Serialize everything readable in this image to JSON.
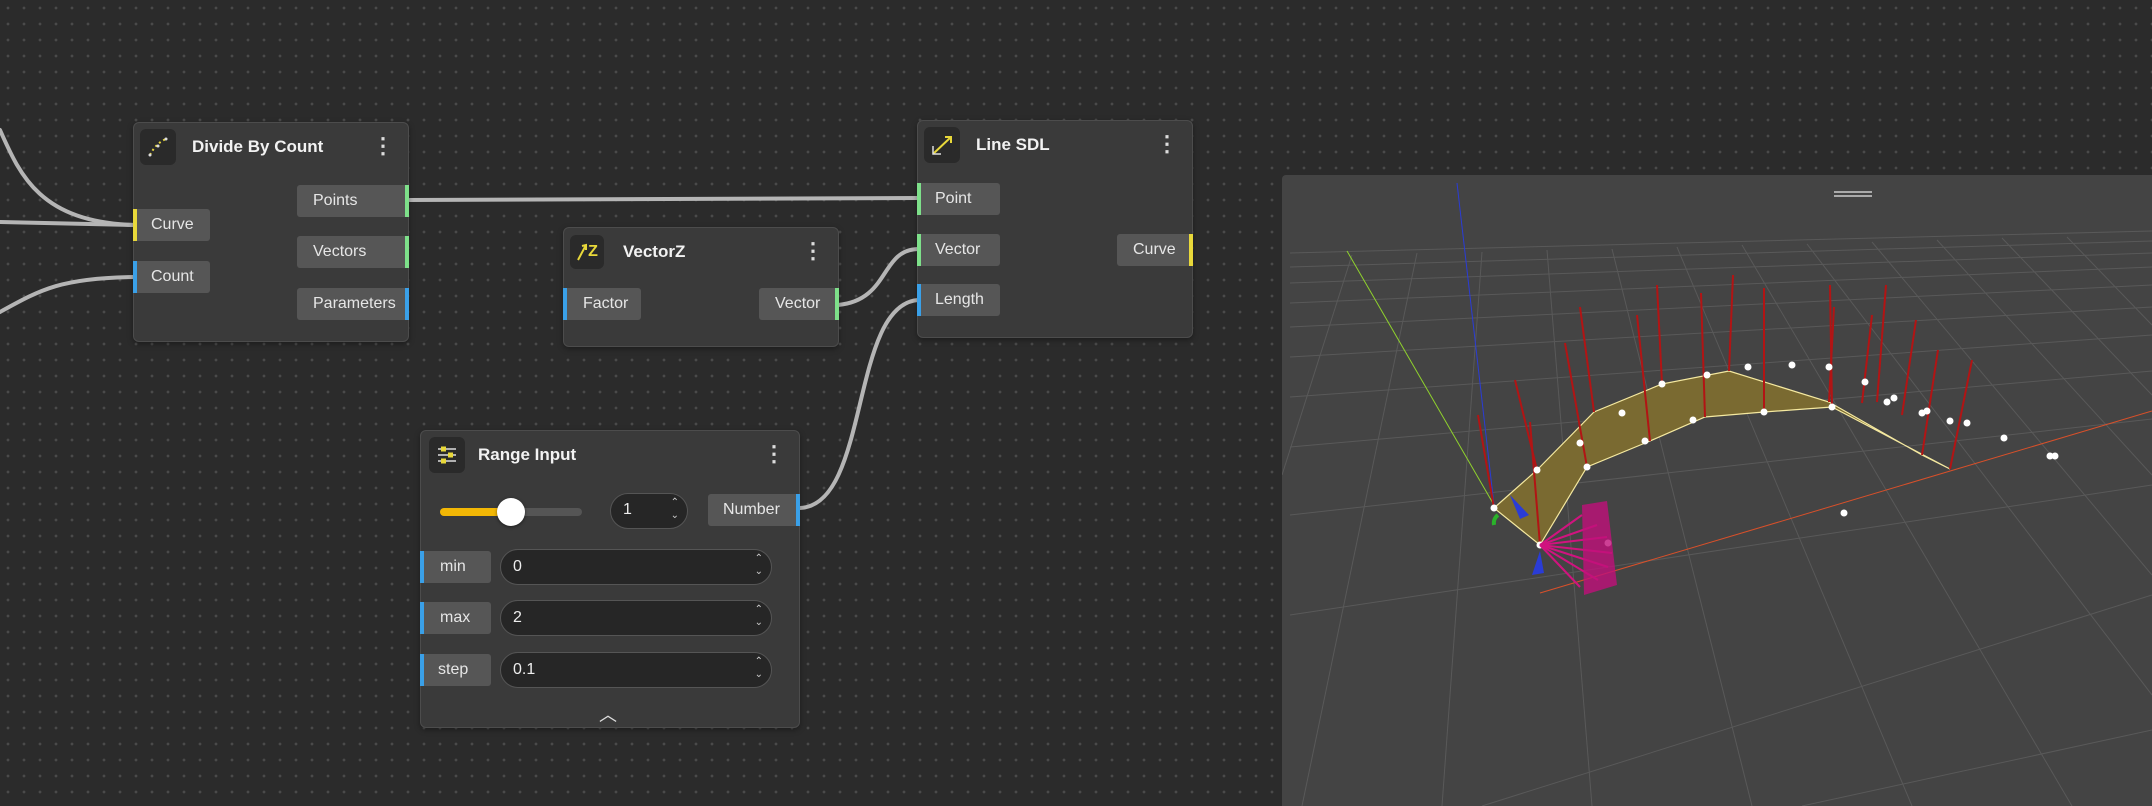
{
  "nodes": {
    "divide_by_count": {
      "title": "Divide By Count",
      "inputs": [
        "Curve",
        "Count"
      ],
      "outputs": [
        "Points",
        "Vectors",
        "Parameters"
      ]
    },
    "vectorz": {
      "title": "VectorZ",
      "icon_text": "Z",
      "inputs": [
        "Factor"
      ],
      "outputs": [
        "Vector"
      ]
    },
    "line_sdl": {
      "title": "Line SDL",
      "inputs": [
        "Point",
        "Vector",
        "Length"
      ],
      "outputs": [
        "Curve"
      ]
    },
    "range_input": {
      "title": "Range Input",
      "slider_fraction": 0.5,
      "value": "1",
      "output": "Number",
      "min_label": "min",
      "min_value": "0",
      "max_label": "max",
      "max_value": "2",
      "step_label": "step",
      "step_value": "0.1"
    }
  },
  "icons": {
    "menu": "vertical-ellipsis-icon",
    "spinner_up": "chevron-up-icon",
    "spinner_down": "chevron-down-icon",
    "collapse": "chevron-up-icon",
    "viewport_handle": "drag-handle-icon"
  },
  "port_colors": {
    "curve": "#e8d83a",
    "number": "#3aa0e8",
    "vector": "#7ee08a"
  },
  "glyphs": {
    "menu": "⋮",
    "up": "⌃",
    "down": "⌄",
    "collapse": "︿"
  }
}
